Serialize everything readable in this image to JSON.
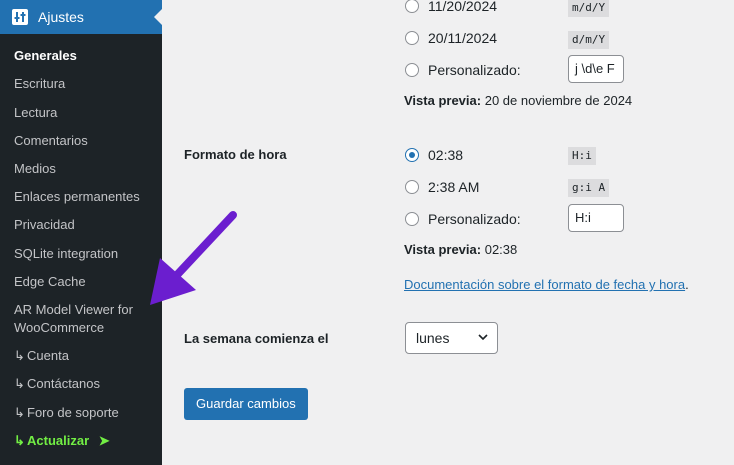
{
  "sidebar": {
    "menu_title": "Ajustes",
    "items": [
      {
        "label": "Generales"
      },
      {
        "label": "Escritura"
      },
      {
        "label": "Lectura"
      },
      {
        "label": "Comentarios"
      },
      {
        "label": "Medios"
      },
      {
        "label": "Enlaces permanentes"
      },
      {
        "label": "Privacidad"
      },
      {
        "label": "SQLite integration"
      },
      {
        "label": "Edge Cache"
      },
      {
        "label": "AR Model Viewer for WooCommerce"
      },
      {
        "label": "Cuenta"
      },
      {
        "label": "Contáctanos"
      },
      {
        "label": "Foro de soporte"
      },
      {
        "label": "Actualizar"
      }
    ],
    "hook_glyph": "↳",
    "upgrade_glyph": "➤"
  },
  "date_format": {
    "options": [
      {
        "label": "11/20/2024",
        "code": "m/d/Y"
      },
      {
        "label": "20/11/2024",
        "code": "d/m/Y"
      },
      {
        "label": "Personalizado:",
        "value": "j \\d\\e F"
      }
    ],
    "preview_label": "Vista previa:",
    "preview_value": "20 de noviembre de 2024"
  },
  "time_format": {
    "label": "Formato de hora",
    "options": [
      {
        "label": "02:38",
        "code": "H:i",
        "checked": true
      },
      {
        "label": "2:38 AM",
        "code": "g:i A"
      },
      {
        "label": "Personalizado:",
        "value": "H:i"
      }
    ],
    "preview_label": "Vista previa:",
    "preview_value": "02:38"
  },
  "doc_link": "Documentación sobre el formato de fecha y hora",
  "doc_link_suffix": ".",
  "week_start": {
    "label": "La semana comienza el",
    "selected": "lunes"
  },
  "save_button": "Guardar cambios",
  "colors": {
    "accent": "#2271b1",
    "sidebar_bg": "#1d2327",
    "highlight_green": "#72ee44",
    "annotation_arrow": "#6b1ecf"
  }
}
